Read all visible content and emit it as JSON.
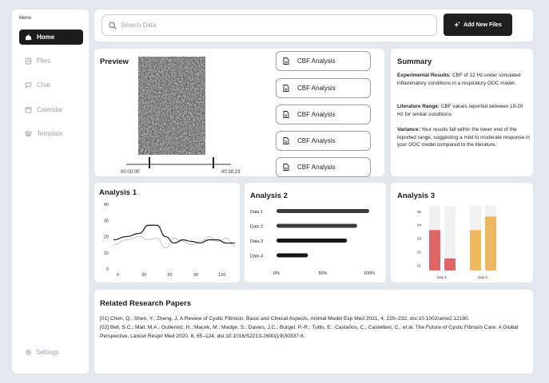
{
  "sidebar": {
    "menu_label": "Menu",
    "items": [
      {
        "label": "Home",
        "icon": "home-icon"
      },
      {
        "label": "Files",
        "icon": "files-icon"
      },
      {
        "label": "Chat",
        "icon": "chat-icon"
      },
      {
        "label": "Calendar",
        "icon": "calendar-icon"
      },
      {
        "label": "Template",
        "icon": "layers-icon"
      }
    ],
    "settings_label": "Settings"
  },
  "search": {
    "placeholder": "Search Data"
  },
  "add_files_label": "Add New Files",
  "preview": {
    "title": "Preview",
    "time_start": "00:00:00",
    "time_end": "00:30:23",
    "analysis_buttons": [
      "CBF Analysis",
      "CBF Analysis",
      "CBF Analysis",
      "CBF Analysis",
      "CBF Analysis"
    ]
  },
  "summary": {
    "title": "Summary",
    "items": [
      {
        "label": "Experimental Results:",
        "text": " CBF of 12 Hz under simulated inflammatory conditions in a respiratory OOC model."
      },
      {
        "label": "Literature Range:",
        "text": " CBF values reported between 10-20 Hz for similar conditions."
      },
      {
        "label": "Variance:",
        "text": " Your results fall within the lower end of the reported range, suggesting a mild to moderate response in your OOC model compared to the literature."
      }
    ]
  },
  "colors": {
    "accent_dark": "#1f1f1f",
    "bar_red": "#e06567",
    "bar_orange": "#f0b85e",
    "bar_bg": "#f1f1f1"
  },
  "chart_data": [
    {
      "type": "line",
      "title": "Analysis 1",
      "x_ticks": [
        0,
        30,
        60,
        90,
        120
      ],
      "y_ticks": [
        0,
        10,
        20,
        30,
        40
      ],
      "ylim": [
        0,
        40
      ],
      "xlim": [
        -5,
        135
      ],
      "series": [
        {
          "color": "#2a2a2a",
          "points": [
            [
              -5,
              18
            ],
            [
              10,
              20
            ],
            [
              25,
              22
            ],
            [
              35,
              27
            ],
            [
              45,
              27
            ],
            [
              55,
              20
            ],
            [
              65,
              16
            ],
            [
              75,
              18
            ],
            [
              85,
              17
            ],
            [
              95,
              16
            ],
            [
              105,
              18
            ],
            [
              115,
              18
            ],
            [
              125,
              16
            ],
            [
              135,
              16
            ]
          ]
        },
        {
          "color": "#c4c4c4",
          "points": [
            [
              -5,
              15
            ],
            [
              10,
              18
            ],
            [
              25,
              20
            ],
            [
              35,
              18
            ],
            [
              45,
              19
            ],
            [
              55,
              13
            ],
            [
              65,
              19
            ],
            [
              75,
              17
            ],
            [
              85,
              15
            ],
            [
              95,
              17
            ],
            [
              105,
              20
            ],
            [
              115,
              17
            ],
            [
              125,
              19
            ],
            [
              135,
              14
            ]
          ]
        }
      ]
    },
    {
      "type": "bar",
      "orientation": "horizontal",
      "title": "Analysis 2",
      "categories": [
        "Data 1",
        "Data 2",
        "Data 3",
        "Data 4"
      ],
      "values": [
        100,
        87,
        76,
        34
      ],
      "x_ticks": [
        "0%",
        "50%",
        "100%"
      ],
      "xlim": [
        0,
        100
      ]
    },
    {
      "type": "bar",
      "title": "Analysis 3",
      "categories": [
        "Day 1",
        "Day 2"
      ],
      "y_ticks": [
        "01",
        "02",
        "03",
        "04",
        "05"
      ],
      "ylim": [
        0.6,
        5.4
      ],
      "groups": [
        {
          "label": "Day 1",
          "values": [
            3.6,
            1.5
          ],
          "colors": [
            "#e06567",
            "#e06567"
          ]
        },
        {
          "label": "Day 2",
          "values": [
            3.6,
            4.6
          ],
          "colors": [
            "#f0b85e",
            "#f0b85e"
          ]
        }
      ]
    }
  ],
  "papers": {
    "title": "Related Research Papers",
    "entries": [
      "[01] Chen, Q.; Shen, Y.; Zheng, J. A Review of Cystic Fibrosis: Basic and Clinical Aspects. Animal Model Exp Med 2021, 4, 220–232, doi:10.1002/ame2.12180.",
      "[02] Bell, S.C.; Mall, M.A.; Gutierrez, H.; Macek, M.; Madge, S.; Davies, J.C.; Burgel, P.-R.; Tullis, E.; Castaños, C.; Castellani, C.; et al. The Future of Cystic Fibrosis Care: A Global Perspective. Lancet Respir Med 2020, 8, 65–124, doi:10.1016/S2213-2600(19)30337-6."
    ]
  }
}
